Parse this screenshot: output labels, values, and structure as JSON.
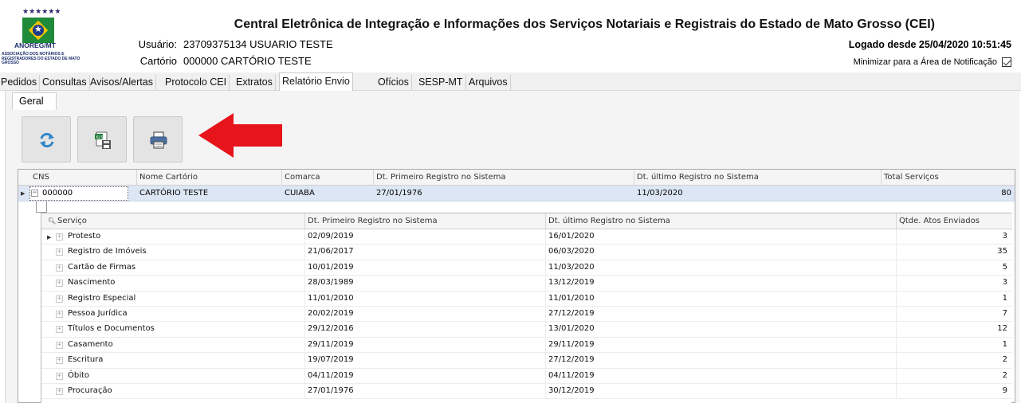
{
  "header": {
    "logo": {
      "stars": "★★★★★★",
      "brand": "ANOREG/MT",
      "subtitle": "ASSOCIAÇÃO DOS NOTÁRIOS E REGISTRADORES DO ESTADO DE MATO GROSSO"
    },
    "title": "Central Eletrônica de Integração e Informações dos Serviços Notariais e Registrais do Estado de Mato Grosso (CEI)",
    "user_label": "Usuário:",
    "user_value": "23709375134 USUARIO TESTE",
    "cartorio_label": "Cartório",
    "cartorio_value": "000000 CARTÓRIO TESTE",
    "logged_since": "Logado desde 25/04/2020 10:51:45",
    "minimize_label": "Minimizar para a Área de Notificação",
    "minimize_checked": true
  },
  "tabs": [
    {
      "label": "Pedidos",
      "active": false
    },
    {
      "label": "Consultas",
      "active": false
    },
    {
      "label": "Avisos/Alertas",
      "active": false
    },
    {
      "label": "Protocolo CEI",
      "active": false
    },
    {
      "label": "Extratos",
      "active": false
    },
    {
      "label": "Relatório Envio",
      "active": true
    },
    {
      "label": "Ofícios",
      "active": false
    },
    {
      "label": "SESP-MT",
      "active": false
    },
    {
      "label": "Arquivos",
      "active": false
    }
  ],
  "subtab": {
    "label": "Geral"
  },
  "toolbar": {
    "buttons": [
      {
        "icon": "refresh-icon"
      },
      {
        "icon": "excel-save-icon"
      },
      {
        "icon": "printer-icon"
      }
    ],
    "arrow_color": "#e8141c"
  },
  "grid": {
    "columns": [
      "CNS",
      "Nome Cartório",
      "Comarca",
      "Dt. Primeiro Registro no Sistema",
      "Dt. último Registro no Sistema",
      "Total Serviços"
    ],
    "row": {
      "cns": "000000",
      "nome": "CARTÓRIO TESTE",
      "comarca": "CUIABA",
      "primeiro": "27/01/1976",
      "ultimo": "11/03/2020",
      "total": "80"
    },
    "detail_columns": [
      "Serviço",
      "Dt. Primeiro Registro no Sistema",
      "Dt. último Registro no Sistema",
      "Qtde. Atos Enviados"
    ],
    "detail_rows": [
      {
        "servico": "Protesto",
        "primeiro": "02/09/2019",
        "ultimo": "16/01/2020",
        "qtde": "3"
      },
      {
        "servico": "Registro de Imóveis",
        "primeiro": "21/06/2017",
        "ultimo": "06/03/2020",
        "qtde": "35"
      },
      {
        "servico": "Cartão de Firmas",
        "primeiro": "10/01/2019",
        "ultimo": "11/03/2020",
        "qtde": "5"
      },
      {
        "servico": "Nascimento",
        "primeiro": "28/03/1989",
        "ultimo": "13/12/2019",
        "qtde": "3"
      },
      {
        "servico": "Registro Especial",
        "primeiro": "11/01/2010",
        "ultimo": "11/01/2010",
        "qtde": "1"
      },
      {
        "servico": "Pessoa Jurídica",
        "primeiro": "20/02/2019",
        "ultimo": "27/12/2019",
        "qtde": "7"
      },
      {
        "servico": "Títulos e Documentos",
        "primeiro": "29/12/2016",
        "ultimo": "13/01/2020",
        "qtde": "12"
      },
      {
        "servico": "Casamento",
        "primeiro": "29/11/2019",
        "ultimo": "29/11/2019",
        "qtde": "1"
      },
      {
        "servico": "Escritura",
        "primeiro": "19/07/2019",
        "ultimo": "27/12/2019",
        "qtde": "2"
      },
      {
        "servico": "Óbito",
        "primeiro": "04/11/2019",
        "ultimo": "04/11/2019",
        "qtde": "2"
      },
      {
        "servico": "Procuração",
        "primeiro": "27/01/1976",
        "ultimo": "30/12/2019",
        "qtde": "9"
      }
    ]
  }
}
